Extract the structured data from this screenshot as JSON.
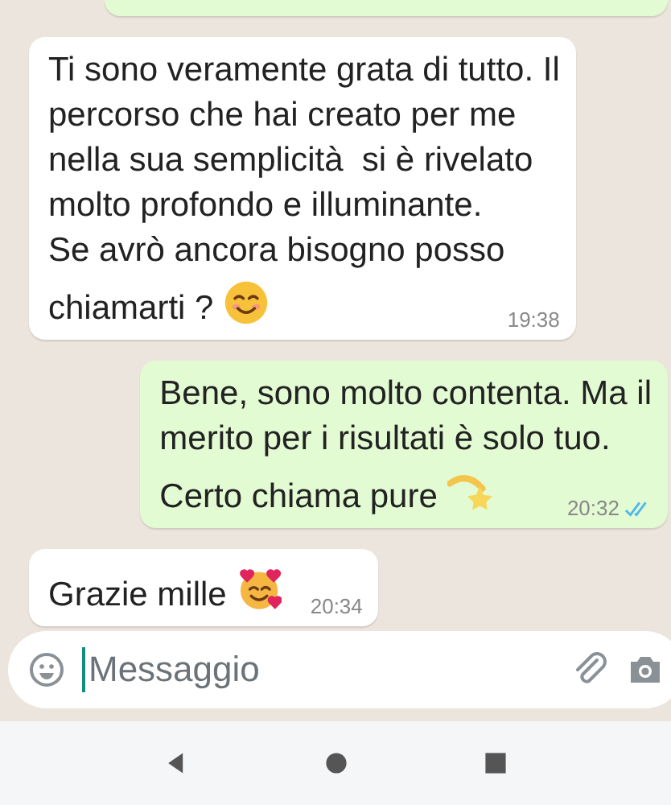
{
  "messages": [
    {
      "kind": "outgoing",
      "cut_off": true
    },
    {
      "kind": "incoming",
      "text": "Ti sono veramente grata di tutto. Il\npercorso che hai creato per me\nnella sua semplicità  si è rivelato\nmolto profondo e illuminante.\nSe avrò ancora bisogno posso\nchiamarti ?",
      "emoji": {
        "kind": "smile"
      },
      "time": "19:38"
    },
    {
      "kind": "outgoing",
      "text": "Bene, sono molto contenta. Ma il\nmerito per i risultati è solo tuo.\nCerto chiama pure",
      "emoji": {
        "kind": "star"
      },
      "time": "20:32",
      "read": true
    },
    {
      "kind": "incoming",
      "text": "Grazie mille",
      "emoji": {
        "kind": "hearts"
      },
      "time": "20:34"
    }
  ],
  "composer": {
    "placeholder": "Messaggio"
  }
}
